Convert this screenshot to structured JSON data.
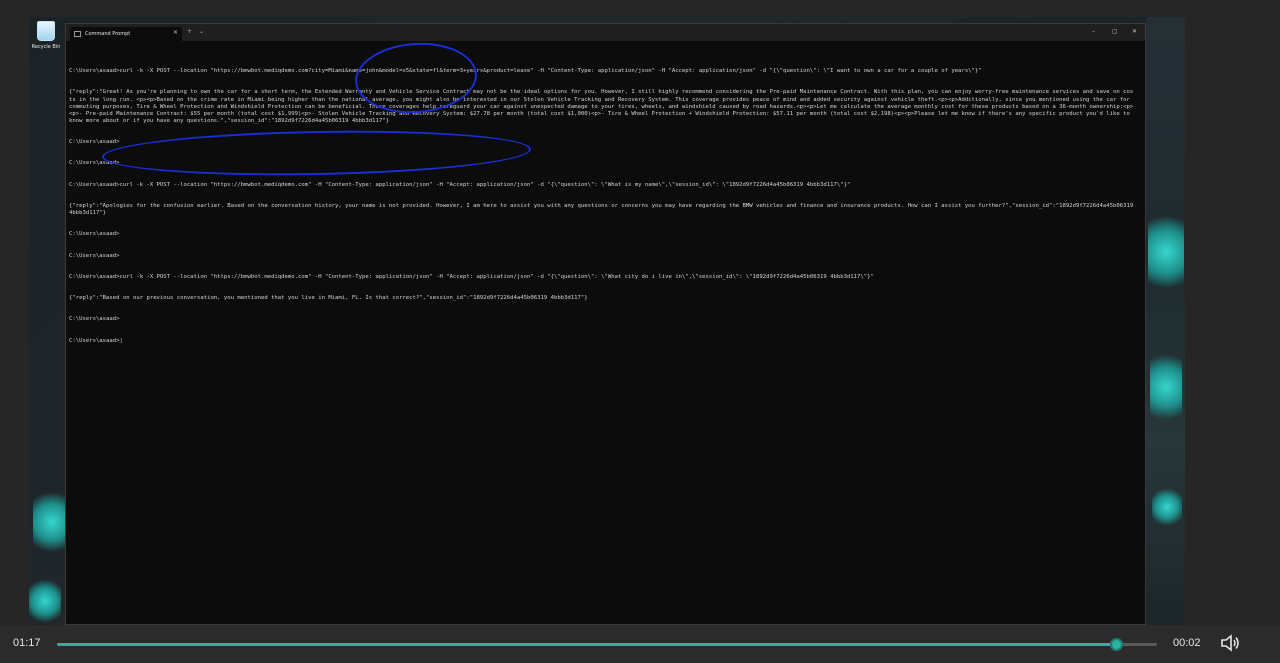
{
  "desktop": {
    "recycle_bin_label": "Recycle Bin"
  },
  "window": {
    "tab_title": "Command Prompt",
    "new_tab": "+",
    "dropdown": "⌄",
    "minimize": "–",
    "maximize": "▢",
    "close": "✕",
    "tab_close": "✕"
  },
  "console": {
    "lines": [
      "C:\\Users\\asaad>curl -k -X POST --location \"https://bmwbot.mediqdemo.com?city=Miami&name=john&model=x5&state=fl&term=3+years&product=lease\" -H \"Content-Type: application/json\" -H \"Accept: application/json\" -d \"{\\\"question\\\": \\\"I want to own a car for a couple of years\\\"}\"",
      "{\"reply\":\"Great! As you're planning to own the car for a short term, the Extended Warranty and Vehicle Service Contract may not be the ideal options for you. However, I still highly recommend considering the Pre-paid Maintenance Contract. With this plan, you can enjoy worry-free maintenance services and save on costs in the long run. <p><p>Based on the crime rate in Miami being higher than the national average, you might also be interested in our Stolen Vehicle Tracking and Recovery System. This coverage provides peace of mind and added security against vehicle theft.<p><p>Additionally, since you mentioned using the car for commuting purposes, Tire & Wheel Protection and Windshield Protection can be beneficial. These coverages help safeguard your car against unexpected damage to your tires, wheels, and windshield caused by road hazards.<p><p>Let me calculate the average monthly cost for these products based on a 36-month ownership:<p><p>- Pre-paid Maintenance Contract: $55 per month (total cost $1,999)<p>- Stolen Vehicle Tracking and Recovery System: $27.78 per month (total cost $1,000)<p>- Tire & Wheel Protection + Windshield Protection: $57.11 per month (total cost $2,198)<p><p>Please let me know if there's any specific product you'd like to know more about or if you have any questions.\",\"session_id\":\"1892d9f7226d4a45b06319 4bbb3d117\"}",
      "C:\\Users\\asaad>",
      "C:\\Users\\asaad>",
      "C:\\Users\\asaad>curl -k -X POST --location \"https://bmwbot.mediqdemo.com\" -H \"Content-Type: application/json\" -H \"Accept: application/json\" -d \"{\\\"question\\\": \\\"What is my name\\\",\\\"session_id\\\": \\\"1892d9f7226d4a45b06319 4bbb3d117\\\"}\"",
      "{\"reply\":\"Apologies for the confusion earlier. Based on the conversation history, your name is not provided. However, I am here to assist you with any questions or concerns you may have regarding the BMW vehicles and finance and insurance products. How can I assist you further?\",\"session_id\":\"1892d9f7226d4a45b06319 4bbb3d117\"}",
      "C:\\Users\\asaad>",
      "C:\\Users\\asaad>",
      "C:\\Users\\asaad>curl -k -X POST --location \"https://bmwbot.mediqdemo.com\" -H \"Content-Type: application/json\" -H \"Accept: application/json\" -d \"{\\\"question\\\": \\\"What city do i live in\\\",\\\"session_id\\\": \\\"1892d9f7226d4a45b06319 4bbb3d117\\\"}\"",
      "{\"reply\":\"Based on our previous conversation, you mentioned that you live in Miami, FL. Is that correct?\",\"session_id\":\"1892d9f7226d4a45b06319 4bbb3d117\"}",
      "C:\\Users\\asaad>",
      "C:\\Users\\asaad>|"
    ]
  },
  "player": {
    "elapsed": "01:17",
    "remaining": "00:02",
    "progress_fraction": 0.963,
    "accent_color": "#2bb3a0"
  },
  "icons": {
    "volume": "volume-icon",
    "close": "close-icon",
    "recycle": "recycle-bin-icon"
  }
}
